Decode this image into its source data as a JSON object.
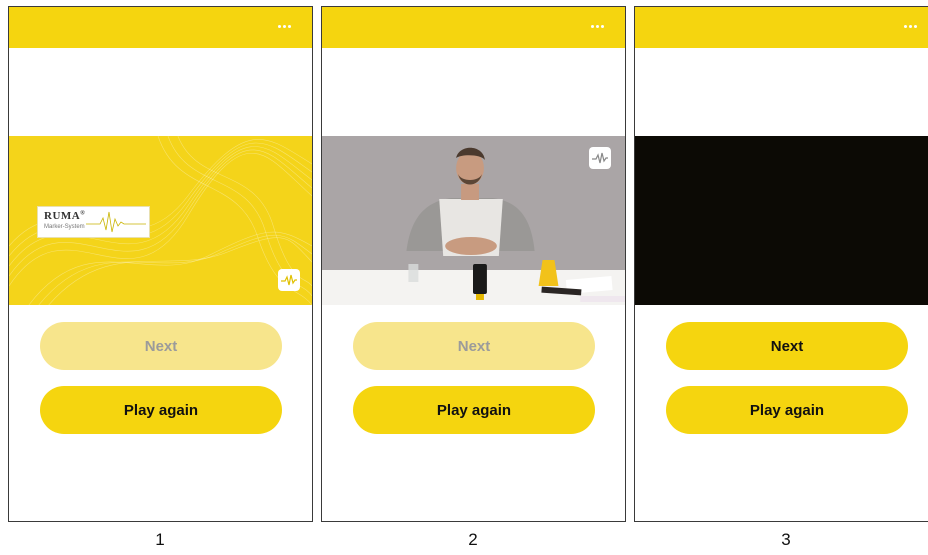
{
  "colors": {
    "accent": "#f5d50f",
    "accent_disabled": "#f7e58c",
    "disabled_text": "#9b9b9b",
    "active_text": "#111111"
  },
  "screens": [
    {
      "caption": "1",
      "menu_icon": "more-horizontal-icon",
      "video": {
        "brand_title": "RUMA",
        "brand_mark": "®",
        "brand_subtitle": "Marker-System",
        "logo_icon": "ruma-pulse-logo-icon"
      },
      "buttons": {
        "next_label": "Next",
        "next_enabled": false,
        "play_again_label": "Play again"
      }
    },
    {
      "caption": "2",
      "menu_icon": "more-horizontal-icon",
      "video": {
        "logo_icon": "ruma-pulse-logo-icon"
      },
      "buttons": {
        "next_label": "Next",
        "next_enabled": false,
        "play_again_label": "Play again"
      }
    },
    {
      "caption": "3",
      "menu_icon": "more-horizontal-icon",
      "video": {},
      "buttons": {
        "next_label": "Next",
        "next_enabled": true,
        "play_again_label": "Play again"
      }
    }
  ]
}
